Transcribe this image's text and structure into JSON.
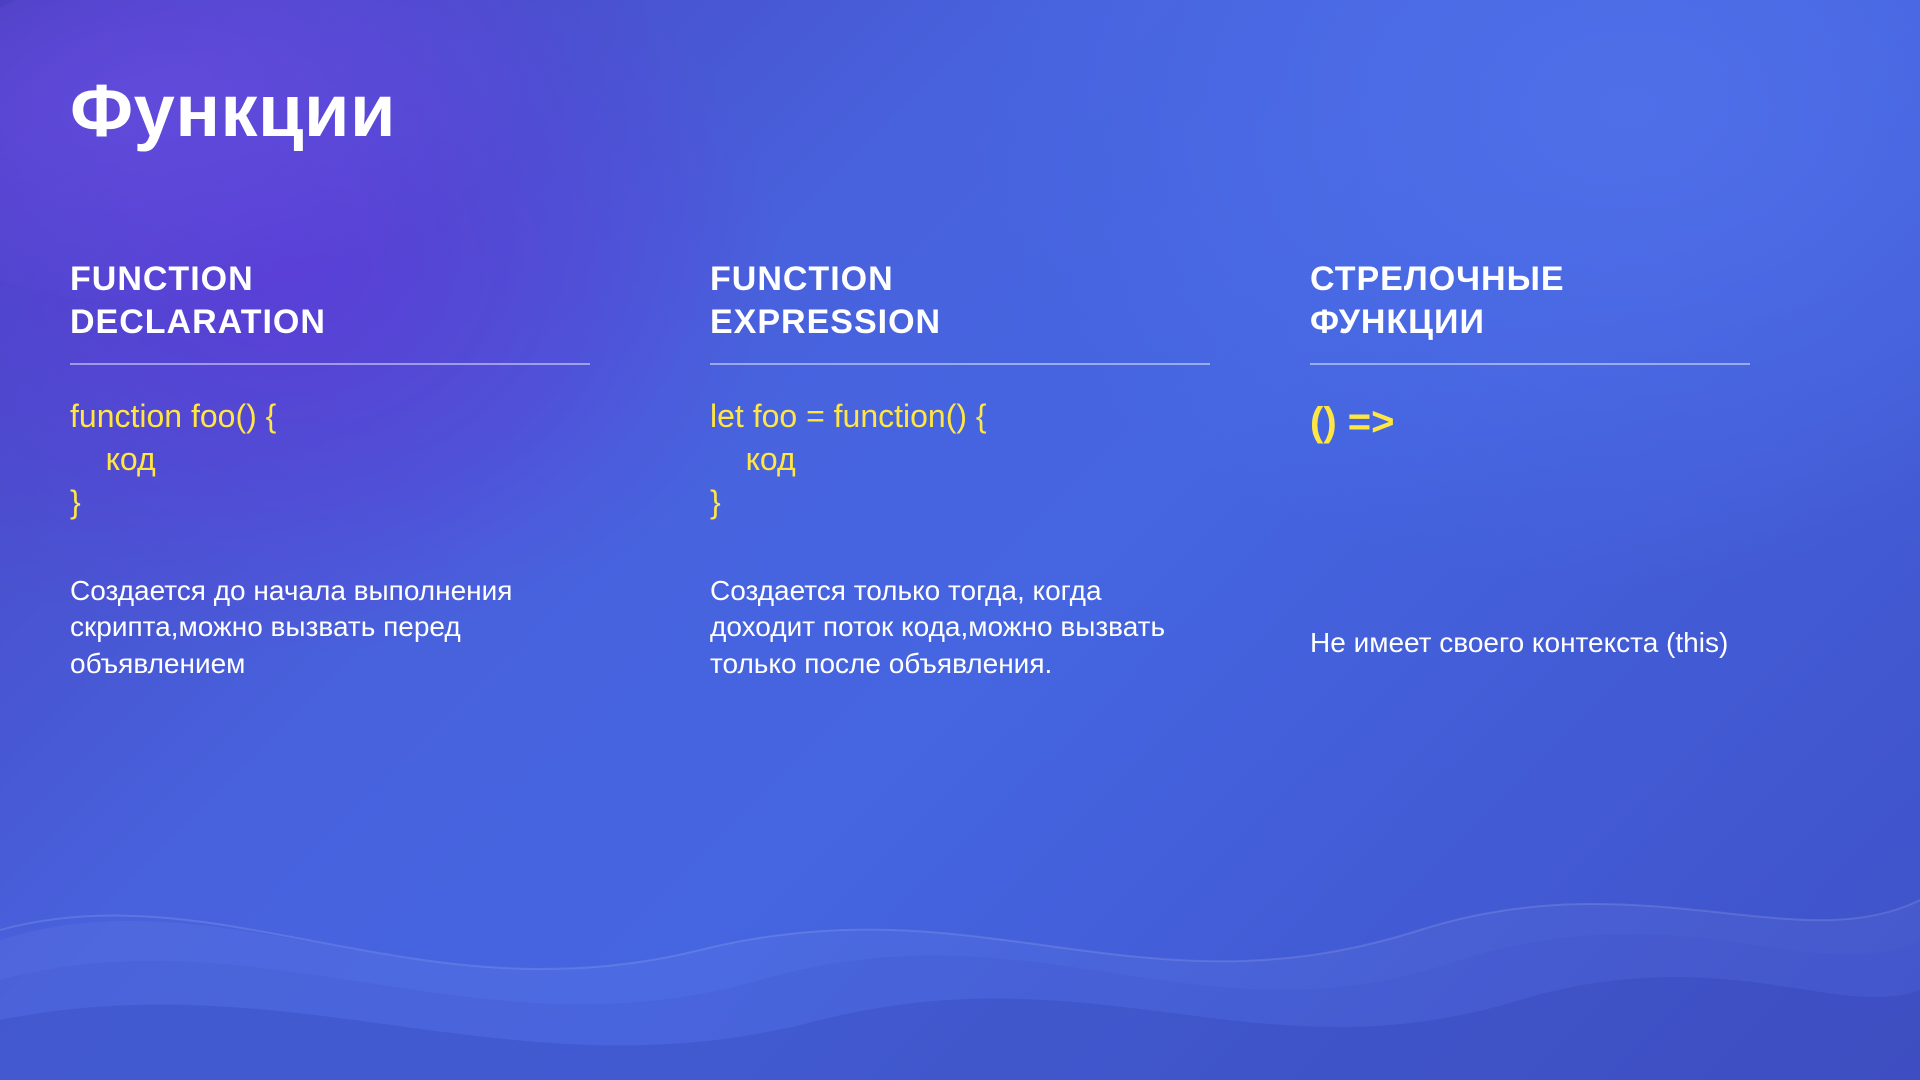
{
  "title": "Функции",
  "columns": [
    {
      "heading": "FUNCTION\nDECLARATION",
      "code": "function foo() {\n    код\n}",
      "description": "Создается до начала выполнения скрипта,можно вызвать перед объявлением"
    },
    {
      "heading": "FUNCTION\nEXPRESSION",
      "code": "let foo = function() {\n    код\n}",
      "description": "Создается только тогда, когда доходит поток кода,можно вызвать только после объявления."
    },
    {
      "heading": "СТРЕЛОЧНЫЕ\nФУНКЦИИ",
      "code": "() =>",
      "description": "Не имеет своего контекста (this)"
    }
  ]
}
